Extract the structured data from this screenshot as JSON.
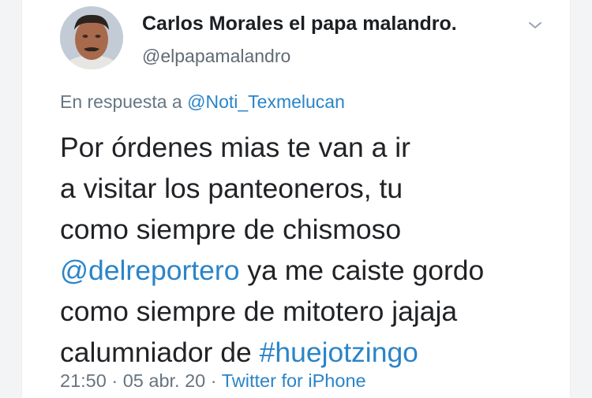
{
  "tweet": {
    "display_name": "Carlos Morales el papa malandro.",
    "handle": "@elpapamalandro",
    "reply_prefix": "En respuesta a ",
    "reply_to": "@Noti_Texmelucan",
    "lines": {
      "l1": "Por órdenes mias te van a ir",
      "l2": "a visitar los panteoneros, tu",
      "l3": "como siempre de chismoso",
      "l4_mention": "@delreportero",
      "l4_rest": " ya me caiste gordo",
      "l5": "como siempre de mitotero jajaja",
      "l6_text": "calumniador de ",
      "l6_hashtag": "#huejotzingo"
    },
    "time": "21:50",
    "separator": " · ",
    "date": "05 abr. 20",
    "source": "Twitter for iPhone"
  },
  "icons": {
    "menu": "chevron-down-icon",
    "avatar": "profile-photo"
  },
  "colors": {
    "link": "#2a84c8",
    "text": "#202226",
    "muted": "#677480"
  }
}
